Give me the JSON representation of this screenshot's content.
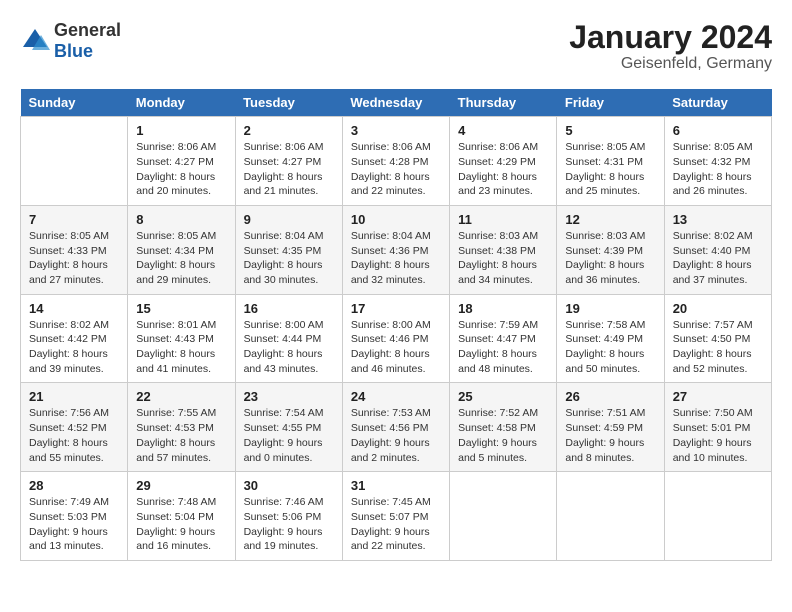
{
  "header": {
    "logo": {
      "general": "General",
      "blue": "Blue"
    },
    "title": "January 2024",
    "subtitle": "Geisenfeld, Germany"
  },
  "days_of_week": [
    "Sunday",
    "Monday",
    "Tuesday",
    "Wednesday",
    "Thursday",
    "Friday",
    "Saturday"
  ],
  "weeks": [
    [
      {
        "day": "",
        "info": ""
      },
      {
        "day": "1",
        "info": "Sunrise: 8:06 AM\nSunset: 4:27 PM\nDaylight: 8 hours\nand 20 minutes."
      },
      {
        "day": "2",
        "info": "Sunrise: 8:06 AM\nSunset: 4:27 PM\nDaylight: 8 hours\nand 21 minutes."
      },
      {
        "day": "3",
        "info": "Sunrise: 8:06 AM\nSunset: 4:28 PM\nDaylight: 8 hours\nand 22 minutes."
      },
      {
        "day": "4",
        "info": "Sunrise: 8:06 AM\nSunset: 4:29 PM\nDaylight: 8 hours\nand 23 minutes."
      },
      {
        "day": "5",
        "info": "Sunrise: 8:05 AM\nSunset: 4:31 PM\nDaylight: 8 hours\nand 25 minutes."
      },
      {
        "day": "6",
        "info": "Sunrise: 8:05 AM\nSunset: 4:32 PM\nDaylight: 8 hours\nand 26 minutes."
      }
    ],
    [
      {
        "day": "7",
        "info": "Sunrise: 8:05 AM\nSunset: 4:33 PM\nDaylight: 8 hours\nand 27 minutes."
      },
      {
        "day": "8",
        "info": "Sunrise: 8:05 AM\nSunset: 4:34 PM\nDaylight: 8 hours\nand 29 minutes."
      },
      {
        "day": "9",
        "info": "Sunrise: 8:04 AM\nSunset: 4:35 PM\nDaylight: 8 hours\nand 30 minutes."
      },
      {
        "day": "10",
        "info": "Sunrise: 8:04 AM\nSunset: 4:36 PM\nDaylight: 8 hours\nand 32 minutes."
      },
      {
        "day": "11",
        "info": "Sunrise: 8:03 AM\nSunset: 4:38 PM\nDaylight: 8 hours\nand 34 minutes."
      },
      {
        "day": "12",
        "info": "Sunrise: 8:03 AM\nSunset: 4:39 PM\nDaylight: 8 hours\nand 36 minutes."
      },
      {
        "day": "13",
        "info": "Sunrise: 8:02 AM\nSunset: 4:40 PM\nDaylight: 8 hours\nand 37 minutes."
      }
    ],
    [
      {
        "day": "14",
        "info": "Sunrise: 8:02 AM\nSunset: 4:42 PM\nDaylight: 8 hours\nand 39 minutes."
      },
      {
        "day": "15",
        "info": "Sunrise: 8:01 AM\nSunset: 4:43 PM\nDaylight: 8 hours\nand 41 minutes."
      },
      {
        "day": "16",
        "info": "Sunrise: 8:00 AM\nSunset: 4:44 PM\nDaylight: 8 hours\nand 43 minutes."
      },
      {
        "day": "17",
        "info": "Sunrise: 8:00 AM\nSunset: 4:46 PM\nDaylight: 8 hours\nand 46 minutes."
      },
      {
        "day": "18",
        "info": "Sunrise: 7:59 AM\nSunset: 4:47 PM\nDaylight: 8 hours\nand 48 minutes."
      },
      {
        "day": "19",
        "info": "Sunrise: 7:58 AM\nSunset: 4:49 PM\nDaylight: 8 hours\nand 50 minutes."
      },
      {
        "day": "20",
        "info": "Sunrise: 7:57 AM\nSunset: 4:50 PM\nDaylight: 8 hours\nand 52 minutes."
      }
    ],
    [
      {
        "day": "21",
        "info": "Sunrise: 7:56 AM\nSunset: 4:52 PM\nDaylight: 8 hours\nand 55 minutes."
      },
      {
        "day": "22",
        "info": "Sunrise: 7:55 AM\nSunset: 4:53 PM\nDaylight: 8 hours\nand 57 minutes."
      },
      {
        "day": "23",
        "info": "Sunrise: 7:54 AM\nSunset: 4:55 PM\nDaylight: 9 hours\nand 0 minutes."
      },
      {
        "day": "24",
        "info": "Sunrise: 7:53 AM\nSunset: 4:56 PM\nDaylight: 9 hours\nand 2 minutes."
      },
      {
        "day": "25",
        "info": "Sunrise: 7:52 AM\nSunset: 4:58 PM\nDaylight: 9 hours\nand 5 minutes."
      },
      {
        "day": "26",
        "info": "Sunrise: 7:51 AM\nSunset: 4:59 PM\nDaylight: 9 hours\nand 8 minutes."
      },
      {
        "day": "27",
        "info": "Sunrise: 7:50 AM\nSunset: 5:01 PM\nDaylight: 9 hours\nand 10 minutes."
      }
    ],
    [
      {
        "day": "28",
        "info": "Sunrise: 7:49 AM\nSunset: 5:03 PM\nDaylight: 9 hours\nand 13 minutes."
      },
      {
        "day": "29",
        "info": "Sunrise: 7:48 AM\nSunset: 5:04 PM\nDaylight: 9 hours\nand 16 minutes."
      },
      {
        "day": "30",
        "info": "Sunrise: 7:46 AM\nSunset: 5:06 PM\nDaylight: 9 hours\nand 19 minutes."
      },
      {
        "day": "31",
        "info": "Sunrise: 7:45 AM\nSunset: 5:07 PM\nDaylight: 9 hours\nand 22 minutes."
      },
      {
        "day": "",
        "info": ""
      },
      {
        "day": "",
        "info": ""
      },
      {
        "day": "",
        "info": ""
      }
    ]
  ]
}
